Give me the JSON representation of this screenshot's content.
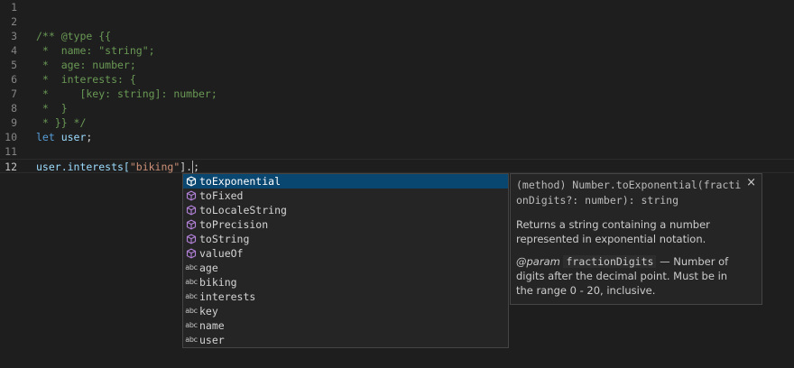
{
  "editor": {
    "line_numbers": [
      "1",
      "2",
      "3",
      "4",
      "5",
      "6",
      "7",
      "8",
      "9",
      "10",
      "11",
      "12"
    ],
    "lines": {
      "l3": "/** @type {{",
      "l4": " *  name: \"string\";",
      "l5": " *  age: number;",
      "l6": " *  interests: {",
      "l7": " *     [key: string]: number;",
      "l8": " *  }",
      "l9": " * }} */",
      "l10_kw": "let",
      "l10_id": " user",
      "l10_end": ";",
      "l12_a": "user.interests[",
      "l12_str": "\"biking\"",
      "l12_b": "].",
      "l12_c": ";"
    }
  },
  "suggest": {
    "items": [
      {
        "label": "toExponential",
        "kind": "method"
      },
      {
        "label": "toFixed",
        "kind": "method"
      },
      {
        "label": "toLocaleString",
        "kind": "method"
      },
      {
        "label": "toPrecision",
        "kind": "method"
      },
      {
        "label": "toString",
        "kind": "method"
      },
      {
        "label": "valueOf",
        "kind": "method"
      },
      {
        "label": "age",
        "kind": "word"
      },
      {
        "label": "biking",
        "kind": "word"
      },
      {
        "label": "interests",
        "kind": "word"
      },
      {
        "label": "key",
        "kind": "word"
      },
      {
        "label": "name",
        "kind": "word"
      },
      {
        "label": "user",
        "kind": "word"
      }
    ],
    "word_icon": "abc",
    "selected_index": 0
  },
  "details": {
    "signature": "(method) Number.toExponential(fractionDigits?: number): string",
    "description": "Returns a string containing a number represented in exponential notation.",
    "param_tag": "@param",
    "param_name": "fractionDigits",
    "param_text": " — Number of digits after the decimal point. Must be in the range 0 - 20, inclusive.",
    "close_symbol": "×"
  },
  "colors": {
    "background": "#1e1e1e",
    "comment": "#6a9955",
    "keyword": "#569cd6",
    "selection": "#094771",
    "method_icon": "#b180d7"
  }
}
